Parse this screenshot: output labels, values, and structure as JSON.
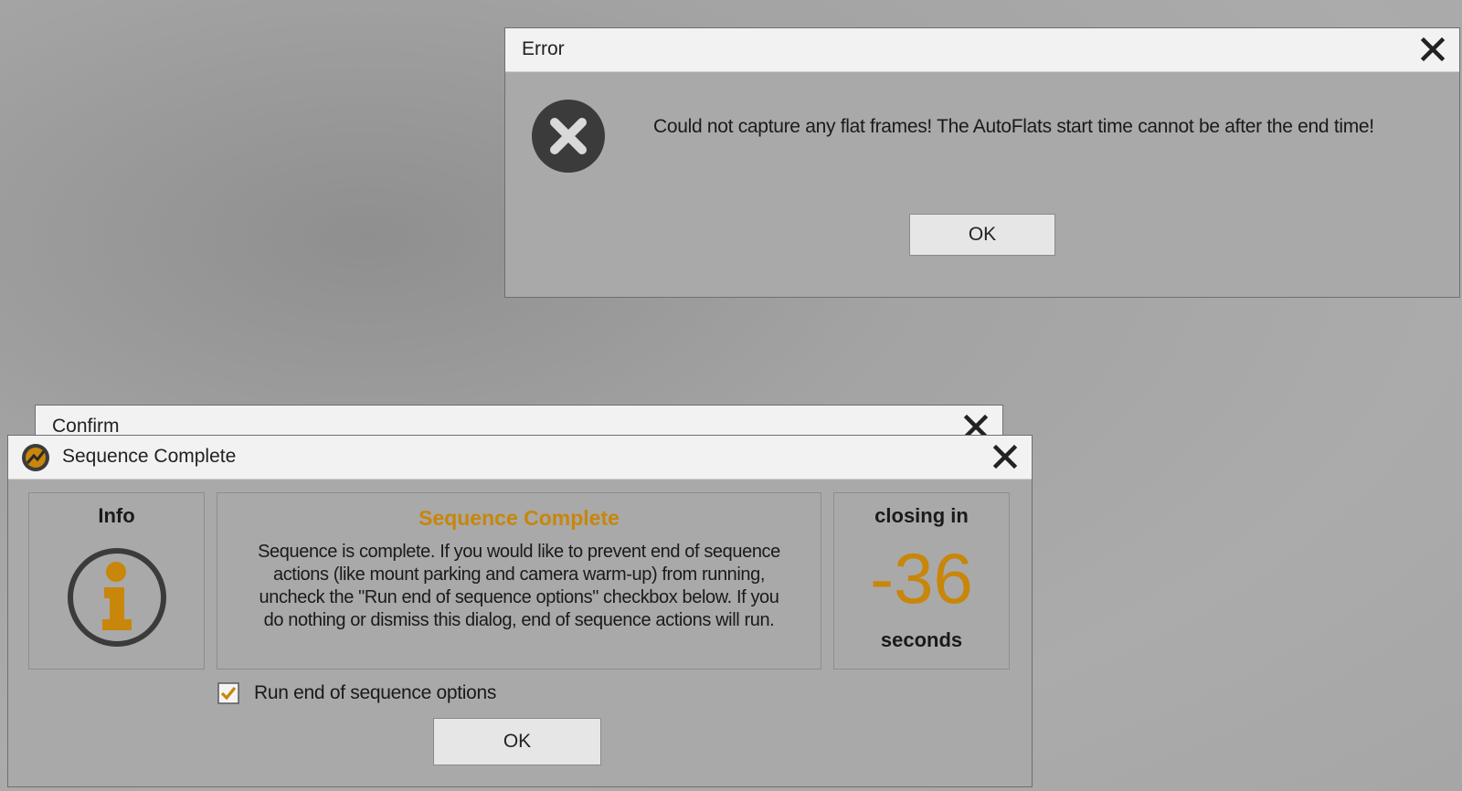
{
  "error_dialog": {
    "title": "Error",
    "message": "Could not capture any flat frames! The AutoFlats start time cannot be after the end time!",
    "ok_label": "OK"
  },
  "confirm_dialog": {
    "title": "Confirm"
  },
  "sequence_dialog": {
    "title": "Sequence Complete",
    "info_label": "Info",
    "heading": "Sequence Complete",
    "body_lines": [
      "Sequence is complete.  If you would like to prevent end of sequence",
      "actions (like mount parking and camera warm-up) from running,",
      "uncheck the \"Run end of sequence options\" checkbox below. If you",
      "do nothing or dismiss this dialog, end of sequence actions will run."
    ],
    "closing_label": "closing in",
    "countdown": "-36",
    "seconds_label": "seconds",
    "checkbox_label": "Run end of sequence options",
    "checkbox_checked": true,
    "ok_label": "OK"
  },
  "colors": {
    "accent": "#c8860a",
    "icon_dark": "#3b3b3b",
    "dialog_bg": "#a9a9a9",
    "titlebar_bg": "#f2f2f2"
  }
}
